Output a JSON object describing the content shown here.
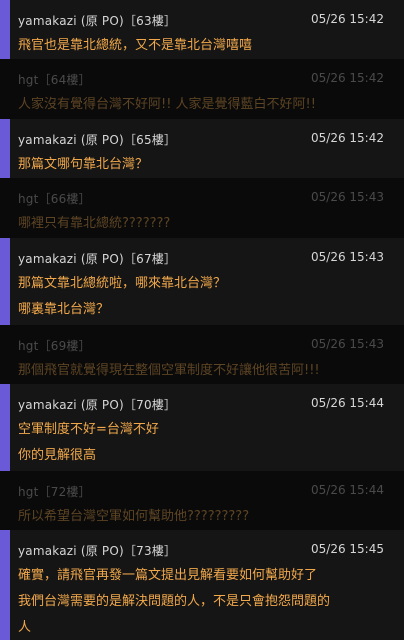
{
  "comments": [
    {
      "author": "yamakazi (原 PO)",
      "floor": "［63樓］",
      "time": "05/26 15:42",
      "is_op": true,
      "lines": [
        "飛官也是靠北總統，又不是靠北台灣嘻嘻"
      ]
    },
    {
      "author": "hgt",
      "floor": "［64樓］",
      "time": "05/26 15:42",
      "is_op": false,
      "lines": [
        "人家沒有覺得台灣不好阿!!  人家是覺得藍白不好阿!!"
      ]
    },
    {
      "author": "yamakazi (原 PO)",
      "floor": "［65樓］",
      "time": "05/26 15:42",
      "is_op": true,
      "lines": [
        "那篇文哪句靠北台灣？"
      ]
    },
    {
      "author": "hgt",
      "floor": "［66樓］",
      "time": "05/26 15:43",
      "is_op": false,
      "lines": [
        "哪裡只有靠北總統???????"
      ]
    },
    {
      "author": "yamakazi (原 PO)",
      "floor": "［67樓］",
      "time": "05/26 15:43",
      "is_op": true,
      "lines": [
        "那篇文靠北總統啦，哪來靠北台灣？",
        "哪裏靠北台灣？"
      ]
    },
    {
      "author": "hgt",
      "floor": "［69樓］",
      "time": "05/26 15:43",
      "is_op": false,
      "lines": [
        "那個飛官就覺得現在整個空軍制度不好讓他很苦阿!!!"
      ]
    },
    {
      "author": "yamakazi (原 PO)",
      "floor": "［70樓］",
      "time": "05/26 15:44",
      "is_op": true,
      "lines": [
        "空軍制度不好=台灣不好",
        "你的見解很高"
      ]
    },
    {
      "author": "hgt",
      "floor": "［72樓］",
      "time": "05/26 15:44",
      "is_op": false,
      "lines": [
        "所以希望台灣空軍如何幫助他?????????"
      ]
    },
    {
      "author": "yamakazi (原 PO)",
      "floor": "［73樓］",
      "time": "05/26 15:45",
      "is_op": true,
      "lines": [
        "確實，請飛官再發一篇文提出見解看要如何幫助好了",
        "我們台灣需要的是解決問題的人，不是只會抱怨問題的",
        "人"
      ]
    }
  ],
  "colors": {
    "op_bar": "#6b5ad8",
    "op_text": "#f1a84a",
    "dim_text": "#5d4424"
  }
}
